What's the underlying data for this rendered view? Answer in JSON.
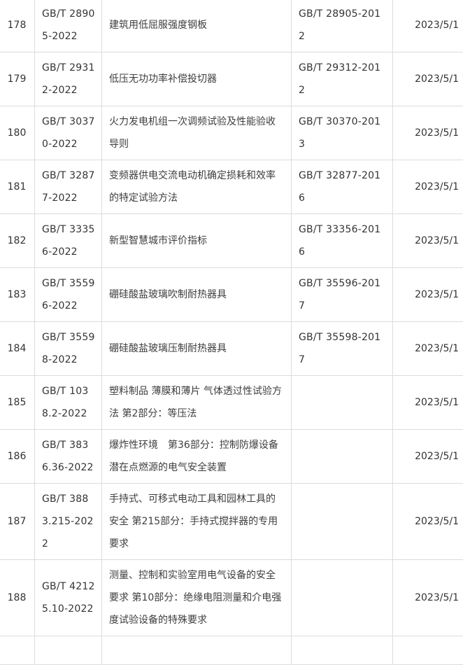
{
  "rows": [
    {
      "no": "178",
      "code": "GB/T 28905-2022",
      "name": "建筑用低屈服强度钢板",
      "replaces": "GB/T 28905-2012",
      "date": "2023/5/1"
    },
    {
      "no": "179",
      "code": "GB/T 29312-2022",
      "name": "低压无功功率补偿投切器",
      "replaces": "GB/T 29312-2012",
      "date": "2023/5/1"
    },
    {
      "no": "180",
      "code": "GB/T 30370-2022",
      "name": "火力发电机组一次调频试验及性能验收导则",
      "replaces": "GB/T 30370-2013",
      "date": "2023/5/1"
    },
    {
      "no": "181",
      "code": "GB/T 32877-2022",
      "name": "变频器供电交流电动机确定损耗和效率的特定试验方法",
      "replaces": "GB/T 32877-2016",
      "date": "2023/5/1"
    },
    {
      "no": "182",
      "code": "GB/T 33356-2022",
      "name": "新型智慧城市评价指标",
      "replaces": "GB/T 33356-2016",
      "date": "2023/5/1"
    },
    {
      "no": "183",
      "code": "GB/T 35596-2022",
      "name": "硼硅酸盐玻璃吹制耐热器具",
      "replaces": "GB/T 35596-2017",
      "date": "2023/5/1"
    },
    {
      "no": "184",
      "code": "GB/T 35598-2022",
      "name": "硼硅酸盐玻璃压制耐热器具",
      "replaces": "GB/T 35598-2017",
      "date": "2023/5/1"
    },
    {
      "no": "185",
      "code": "GB/T 1038.2-2022",
      "name": "塑料制品 薄膜和薄片 气体透过性试验方法 第2部分：等压法",
      "replaces": "",
      "date": "2023/5/1"
    },
    {
      "no": "186",
      "code": "GB/T 3836.36-2022",
      "name": "爆炸性环境　第36部分：控制防爆设备潜在点燃源的电气安全装置",
      "replaces": "",
      "date": "2023/5/1"
    },
    {
      "no": "187",
      "code": "GB/T 3883.215-2022",
      "name": "手持式、可移式电动工具和园林工具的安全 第215部分：手持式搅拌器的专用要求",
      "replaces": "",
      "date": "2023/5/1"
    },
    {
      "no": "188",
      "code": "GB/T 42125.10-2022",
      "name": "测量、控制和实验室用电气设备的安全要求 第10部分：绝缘电阻测量和介电强度试验设备的特殊要求",
      "replaces": "",
      "date": "2023/5/1"
    }
  ]
}
